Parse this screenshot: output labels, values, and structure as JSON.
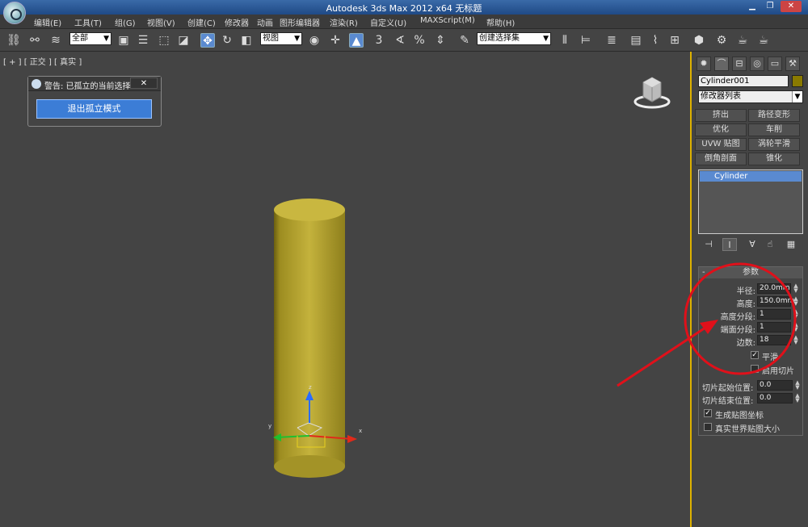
{
  "titlebar": {
    "title": "Autodesk 3ds Max  2012 x64    无标题"
  },
  "menu": [
    "编辑(E)",
    "工具(T)",
    "组(G)",
    "视图(V)",
    "创建(C)",
    "修改器",
    "动画",
    "图形编辑器",
    "渲染(R)",
    "自定义(U)",
    "MAXScript(M)",
    "帮助(H)"
  ],
  "toolbar": {
    "selection_filter": "全部",
    "ref_coord": "视图",
    "named_selection": "创建选择集",
    "snap_label": "3",
    "percent_snap": "%"
  },
  "viewport": {
    "label": "[ + ] [ 正交 ] [ 真实 ]"
  },
  "dialog": {
    "title": "警告: 已孤立的当前选择",
    "close": "✕",
    "button": "退出孤立模式"
  },
  "panel": {
    "object_name": "Cylinder001",
    "modifier_list": "修改器列表",
    "modifier_buttons": [
      "挤出",
      "路径变形",
      "优化",
      "车削",
      "UVW 贴图",
      "涡轮平滑",
      "倒角剖面",
      "锥化"
    ],
    "stack_item": "Cylinder",
    "params_title": "参数",
    "params": [
      {
        "label": "半径:",
        "value": "20.0mm"
      },
      {
        "label": "高度:",
        "value": "150.0mm"
      },
      {
        "label": "高度分段:",
        "value": "1"
      },
      {
        "label": "端面分段:",
        "value": "1"
      },
      {
        "label": "边数:",
        "value": "18"
      }
    ],
    "smooth": "平滑",
    "slice_on": "启用切片",
    "slice_from": {
      "label": "切片起始位置:",
      "value": "0.0"
    },
    "slice_to": {
      "label": "切片结束位置:",
      "value": "0.0"
    },
    "gen_map_coords": "生成贴图坐标",
    "real_world": "真实世界贴图大小"
  },
  "gizmo": {
    "x": "x",
    "y": "y",
    "z": "z"
  },
  "colors": {
    "accent_blue": "#3c7dd6",
    "object_yellow": "#b5a42a",
    "annotation_red": "#e0101a",
    "viewport_border": "#ddb100"
  }
}
